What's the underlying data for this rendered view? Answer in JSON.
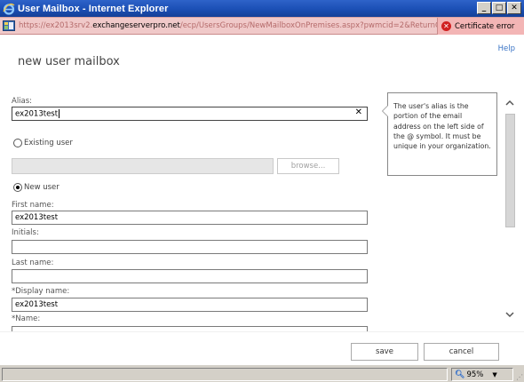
{
  "window": {
    "title": "User Mailbox - Internet Explorer",
    "controls": {
      "minimize": "_",
      "maximize": "□",
      "close": "✕"
    }
  },
  "address_bar": {
    "url_prefix": "https://ex2013srv2.",
    "url_host": "exchangeserverpro.net",
    "url_suffix": "/ecp/UsersGroups/NewMailboxOnPremises.aspx?pwmcid=2&ReturnObje",
    "cert_error": "Certificate error"
  },
  "page": {
    "help": "Help",
    "title": "new user mailbox"
  },
  "form": {
    "alias_label": "Alias:",
    "alias_value": "ex2013test",
    "existing_user_label": "Existing user",
    "browse_label": "browse...",
    "new_user_label": "New user",
    "first_name_label": "First name:",
    "first_name_value": "ex2013test",
    "initials_label": "Initials:",
    "initials_value": "",
    "last_name_label": "Last name:",
    "last_name_value": "",
    "display_name_label": "*Display name:",
    "display_name_value": "ex2013test",
    "name_label": "*Name:",
    "selected_option": "New user"
  },
  "tooltip": {
    "text": "The user's alias is the portion of the email address on the left side of the @ symbol. It must be unique in your organization."
  },
  "buttons": {
    "save": "save",
    "cancel": "cancel"
  },
  "status_bar": {
    "zoom": "95%"
  },
  "colors": {
    "title_bar": "#1b4fb5",
    "address_bar_error": "#f0c9c9",
    "link": "#3a74c5"
  }
}
